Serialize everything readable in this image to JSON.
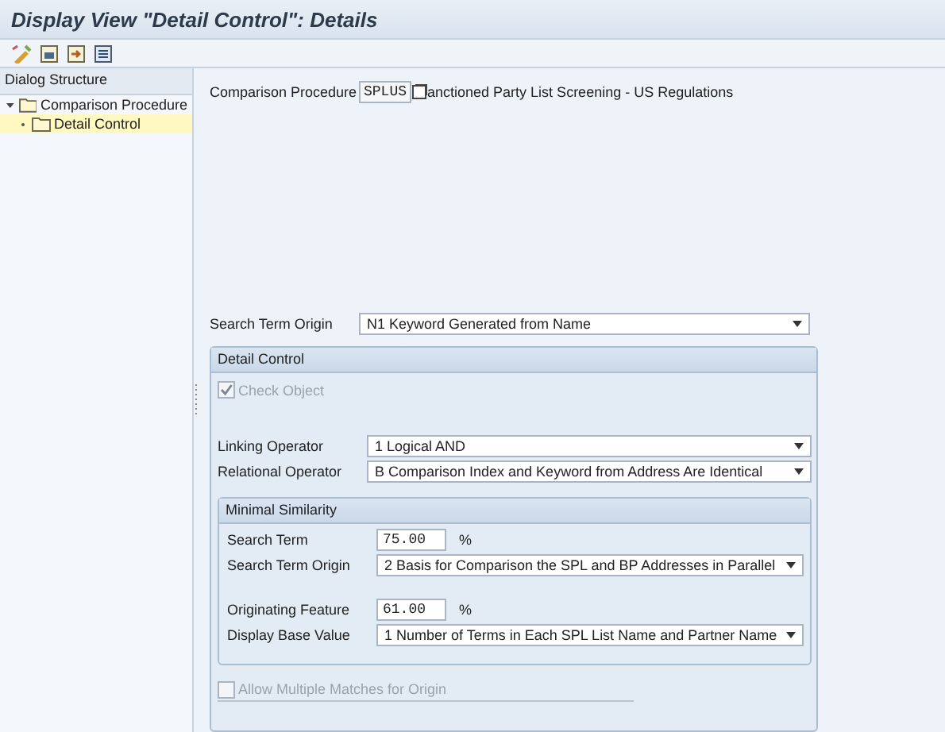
{
  "window": {
    "title": "Display View \"Detail Control\": Details"
  },
  "dialog_structure": {
    "title": "Dialog Structure",
    "tree": [
      {
        "label": "Comparison Procedure",
        "expanded": true,
        "selected": false,
        "children": [
          {
            "label": "Detail Control",
            "selected": true
          }
        ]
      }
    ]
  },
  "header": {
    "comparison_procedure": {
      "label": "Comparison Procedure",
      "code": "SPLUS",
      "description": "anctioned Party List Screening - US Regulations"
    },
    "search_term_origin": {
      "label": "Search Term Origin",
      "value": "N1 Keyword Generated from Name"
    }
  },
  "detail_control": {
    "title": "Detail Control",
    "check_object": {
      "label": "Check Object",
      "checked": true,
      "disabled": true
    },
    "fields": [
      {
        "label": "Linking Operator",
        "value": "1 Logical AND"
      },
      {
        "label": "Relational Operator",
        "value": "B Comparison Index and Keyword from Address Are Identical"
      }
    ],
    "minimal_similarity": {
      "title": "Minimal Similarity",
      "rows": [
        {
          "kind": "number",
          "label": "Search Term",
          "value": "75.00",
          "unit": "%"
        },
        {
          "kind": "dropdown",
          "label": "Search Term Origin",
          "value": "2 Basis for Comparison the SPL and BP Addresses in Parallel"
        },
        {
          "kind": "gap"
        },
        {
          "kind": "number",
          "label": "Originating Feature",
          "value": "61.00",
          "unit": "%"
        },
        {
          "kind": "dropdown",
          "label": "Display Base Value",
          "value": "1 Number of Terms in Each SPL List Name and Partner Name"
        }
      ]
    },
    "allow_multiple": {
      "label": "Allow Multiple Matches for Origin",
      "checked": false,
      "disabled": true
    }
  }
}
